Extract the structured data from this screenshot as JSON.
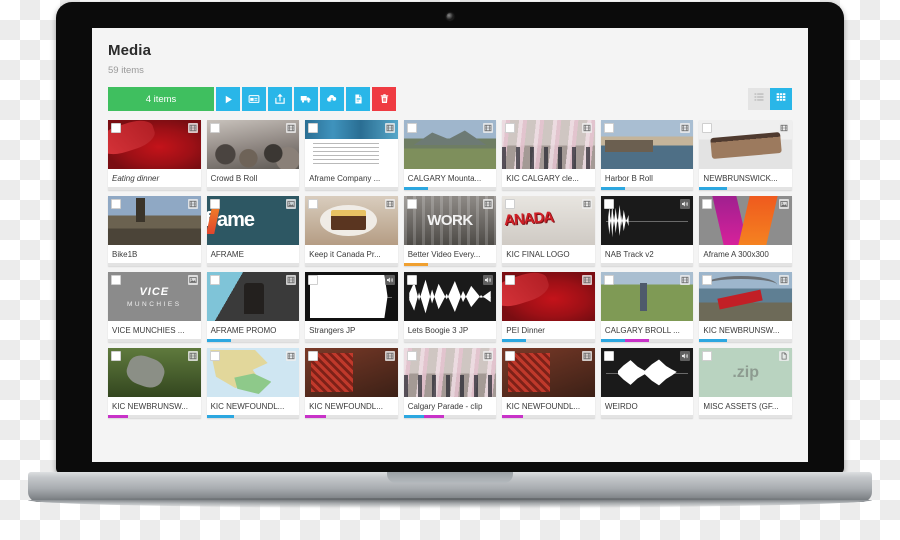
{
  "app": {
    "title": "Media",
    "item_count": "59 items",
    "selection_label": "4 items",
    "toolbar": [
      {
        "name": "play-button",
        "icon": "play-icon",
        "color": "#29b6e8"
      },
      {
        "name": "preview-window-button",
        "icon": "window-icon",
        "color": "#29b6e8"
      },
      {
        "name": "share-button",
        "icon": "share-icon",
        "color": "#29b6e8"
      },
      {
        "name": "deliver-button",
        "icon": "truck-icon",
        "color": "#29b6e8"
      },
      {
        "name": "download-button",
        "icon": "cloud-download-icon",
        "color": "#29b6e8"
      },
      {
        "name": "document-button",
        "icon": "document-icon",
        "color": "#29b6e8"
      },
      {
        "name": "delete-button",
        "icon": "trash-icon",
        "color": "#ef3b42"
      }
    ],
    "view_toggle": [
      {
        "name": "list-view-button",
        "icon": "list-icon",
        "active": false
      },
      {
        "name": "grid-view-button",
        "icon": "grid-icon",
        "active": true
      }
    ],
    "colors": {
      "accent": "#29b6e8",
      "selection": "#3fbf5f",
      "danger": "#ef3b42",
      "progress_blue": "#2ca7e0",
      "progress_magenta": "#c832c8",
      "progress_orange": "#f0a030"
    }
  },
  "media_items": [
    {
      "label": "Eating dinner",
      "italic": true,
      "type": "video",
      "art": "art-food1",
      "progress": []
    },
    {
      "label": "Crowd B Roll",
      "italic": false,
      "type": "video",
      "art": "art-crowd",
      "progress": []
    },
    {
      "label": "Aframe Company ...",
      "italic": false,
      "type": "video",
      "art": "art-doc",
      "progress": []
    },
    {
      "label": "CALGARY Mounta...",
      "italic": false,
      "type": "video",
      "art": "art-mount",
      "progress": [
        {
          "color": "#2ca7e0",
          "pct": 26
        }
      ]
    },
    {
      "label": "KIC CALGARY cle...",
      "italic": false,
      "type": "video",
      "art": "art-parade",
      "progress": []
    },
    {
      "label": "Harbor B Roll",
      "italic": false,
      "type": "video",
      "art": "art-harbor",
      "progress": [
        {
          "color": "#2ca7e0",
          "pct": 26
        }
      ]
    },
    {
      "label": "NEWBRUNSWICK...",
      "italic": false,
      "type": "video",
      "art": "art-cake",
      "progress": [
        {
          "color": "#2ca7e0",
          "pct": 30
        }
      ]
    },
    {
      "label": "Bike1B",
      "italic": false,
      "type": "video",
      "art": "art-bike",
      "progress": []
    },
    {
      "label": "AFRAME",
      "italic": false,
      "type": "image",
      "art": "art-aframe",
      "progress": []
    },
    {
      "label": "Keep it Canada Pr...",
      "italic": false,
      "type": "video",
      "art": "art-dessert",
      "progress": []
    },
    {
      "label": "Better Video Every...",
      "italic": false,
      "type": "video",
      "art": "art-work",
      "progress": [
        {
          "color": "#f0a030",
          "pct": 26
        }
      ]
    },
    {
      "label": "KIC FINAL LOGO",
      "italic": false,
      "type": "video",
      "art": "art-canada",
      "progress": []
    },
    {
      "label": "NAB Track v2",
      "italic": false,
      "type": "audio",
      "art": "art-wave",
      "progress": []
    },
    {
      "label": "Aframe A 300x300",
      "italic": false,
      "type": "image",
      "art": "art-amark",
      "progress": []
    },
    {
      "label": "VICE MUNCHIES ...",
      "italic": false,
      "type": "image",
      "art": "art-vice",
      "progress": []
    },
    {
      "label": "AFRAME PROMO",
      "italic": false,
      "type": "video",
      "art": "art-promo",
      "progress": [
        {
          "color": "#2ca7e0",
          "pct": 26
        }
      ]
    },
    {
      "label": "Strangers JP",
      "italic": false,
      "type": "audio",
      "art": "art-wave-blank",
      "progress": []
    },
    {
      "label": "Lets Boogie 3 JP",
      "italic": false,
      "type": "audio",
      "art": "art-wave-full",
      "progress": []
    },
    {
      "label": "PEI Dinner",
      "italic": false,
      "type": "video",
      "art": "art-food1",
      "progress": [
        {
          "color": "#2ca7e0",
          "pct": 26
        }
      ]
    },
    {
      "label": "CALGARY BROLL ...",
      "italic": false,
      "type": "video",
      "art": "art-cows",
      "progress": [
        {
          "color": "#2ca7e0",
          "pct": 26
        },
        {
          "color": "#c832c8",
          "pct": 26
        }
      ]
    },
    {
      "label": "KIC NEWBRUNSW...",
      "italic": false,
      "type": "video",
      "art": "art-bridge",
      "progress": [
        {
          "color": "#2ca7e0",
          "pct": 30
        }
      ]
    },
    {
      "label": "KIC NEWBRUNSW...",
      "italic": false,
      "type": "video",
      "art": "art-forest",
      "progress": [
        {
          "color": "#c832c8",
          "pct": 22
        }
      ]
    },
    {
      "label": "KIC NEWFOUNDL...",
      "italic": false,
      "type": "video",
      "art": "art-map",
      "progress": [
        {
          "color": "#2ca7e0",
          "pct": 30
        }
      ]
    },
    {
      "label": "KIC NEWFOUNDL...",
      "italic": false,
      "type": "video",
      "art": "art-kitchen",
      "progress": [
        {
          "color": "#c832c8",
          "pct": 22
        }
      ]
    },
    {
      "label": "Calgary Parade - clip",
      "italic": false,
      "type": "video",
      "art": "art-parade",
      "progress": [
        {
          "color": "#2ca7e0",
          "pct": 22
        },
        {
          "color": "#c832c8",
          "pct": 22
        }
      ]
    },
    {
      "label": "KIC NEWFOUNDL...",
      "italic": false,
      "type": "video",
      "art": "art-kitchen",
      "progress": [
        {
          "color": "#c832c8",
          "pct": 22
        }
      ]
    },
    {
      "label": "WEIRDO",
      "italic": false,
      "type": "audio",
      "art": "art-wave-mid",
      "progress": []
    },
    {
      "label": "MISC ASSETS (GF...",
      "italic": false,
      "type": "file",
      "art": "art-zip",
      "progress": []
    }
  ]
}
